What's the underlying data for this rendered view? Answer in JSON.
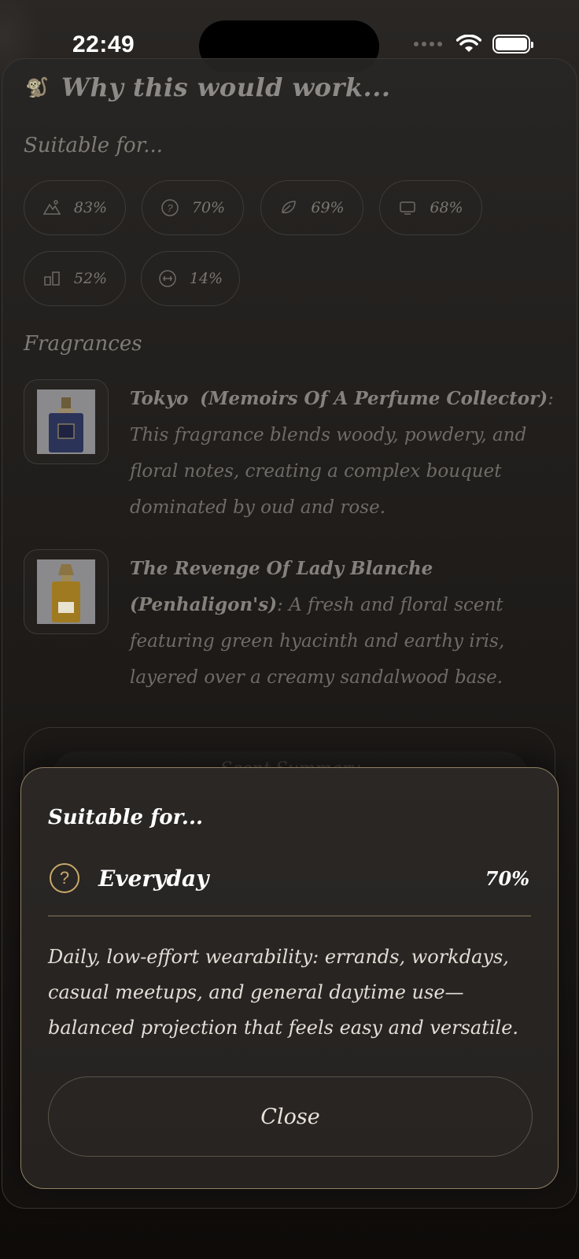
{
  "status": {
    "time": "22:49"
  },
  "header": {
    "title": "Why this would work...",
    "icon": "monkey-icon"
  },
  "suitable": {
    "label": "Suitable for...",
    "chips": [
      {
        "icon": "outdoor-icon",
        "percent": "83%"
      },
      {
        "icon": "question-icon",
        "percent": "70%"
      },
      {
        "icon": "leaf-icon",
        "percent": "69%"
      },
      {
        "icon": "office-icon",
        "percent": "68%"
      },
      {
        "icon": "people-icon",
        "percent": "52%"
      },
      {
        "icon": "dumbbell-icon",
        "percent": "14%"
      }
    ]
  },
  "fragrances": {
    "label": "Fragrances",
    "items": [
      {
        "name": "Tokyo",
        "brand": "(Memoirs Of A Perfume Collector)",
        "description": ": This fragrance blends woody, powdery, and floral notes, creating a complex bouquet dominated by oud and rose."
      },
      {
        "name": "The Revenge Of Lady Blanche",
        "brand": "(Penhaligon's)",
        "description": ": A fresh and floral scent featuring green hyacinth and earthy iris, layered over a creamy sandalwood base."
      }
    ]
  },
  "ghost_button": {
    "label": "Scent Summary"
  },
  "sheet": {
    "title": "Suitable for...",
    "item_label": "Everyday",
    "item_percent": "70%",
    "description": "Daily, low-effort wearability: errands, workdays, casual meetups, and general daytime use—balanced projection that feels easy and versatile.",
    "close_label": "Close",
    "accent_color": "#c7a969"
  }
}
